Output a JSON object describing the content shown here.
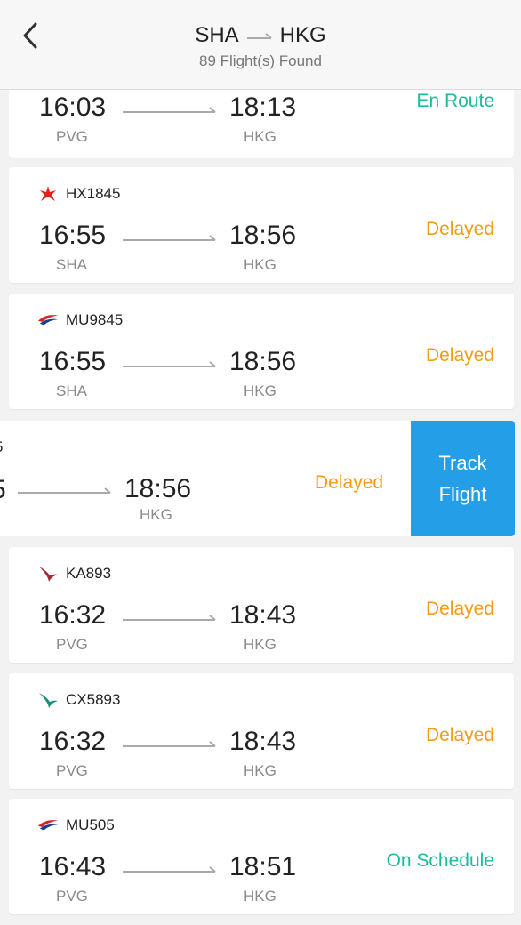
{
  "header": {
    "origin": "SHA",
    "destination": "HKG",
    "found": "89 Flight(s) Found"
  },
  "colors": {
    "delayed": "#f39c12",
    "on_time": "#1abc9c",
    "track_button": "#259ee8"
  },
  "flights": [
    {
      "flight_no": "",
      "airline_icon": "none",
      "dep_time": "16:03",
      "dep_code": "PVG",
      "arr_time": "18:13",
      "arr_code": "HKG",
      "status": "En Route"
    },
    {
      "flight_no": "HX1845",
      "airline_icon": "hong-kong-airlines-logo",
      "dep_time": "16:55",
      "dep_code": "SHA",
      "arr_time": "18:56",
      "arr_code": "HKG",
      "status": "Delayed"
    },
    {
      "flight_no": "MU9845",
      "airline_icon": "china-eastern-logo",
      "dep_time": "16:55",
      "dep_code": "SHA",
      "arr_time": "18:56",
      "arr_code": "HKG",
      "status": "Delayed"
    },
    {
      "flight_no": "KA893",
      "airline_icon": "cathay-dragon-logo",
      "dep_time": "16:32",
      "dep_code": "PVG",
      "arr_time": "18:43",
      "arr_code": "HKG",
      "status": "Delayed"
    },
    {
      "flight_no": "CX5893",
      "airline_icon": "cathay-pacific-logo",
      "dep_time": "16:32",
      "dep_code": "PVG",
      "arr_time": "18:43",
      "arr_code": "HKG",
      "status": "Delayed"
    },
    {
      "flight_no": "MU505",
      "airline_icon": "china-eastern-logo",
      "dep_time": "16:43",
      "dep_code": "PVG",
      "arr_time": "18:51",
      "arr_code": "HKG",
      "status": "On Schedule"
    }
  ],
  "swiped_card": {
    "partial_flight_no": "5",
    "partial_dep_time": "5",
    "arr_time": "18:56",
    "arr_code": "HKG",
    "status": "Delayed",
    "track_button": {
      "line1": "Track",
      "line2": "Flight"
    }
  }
}
